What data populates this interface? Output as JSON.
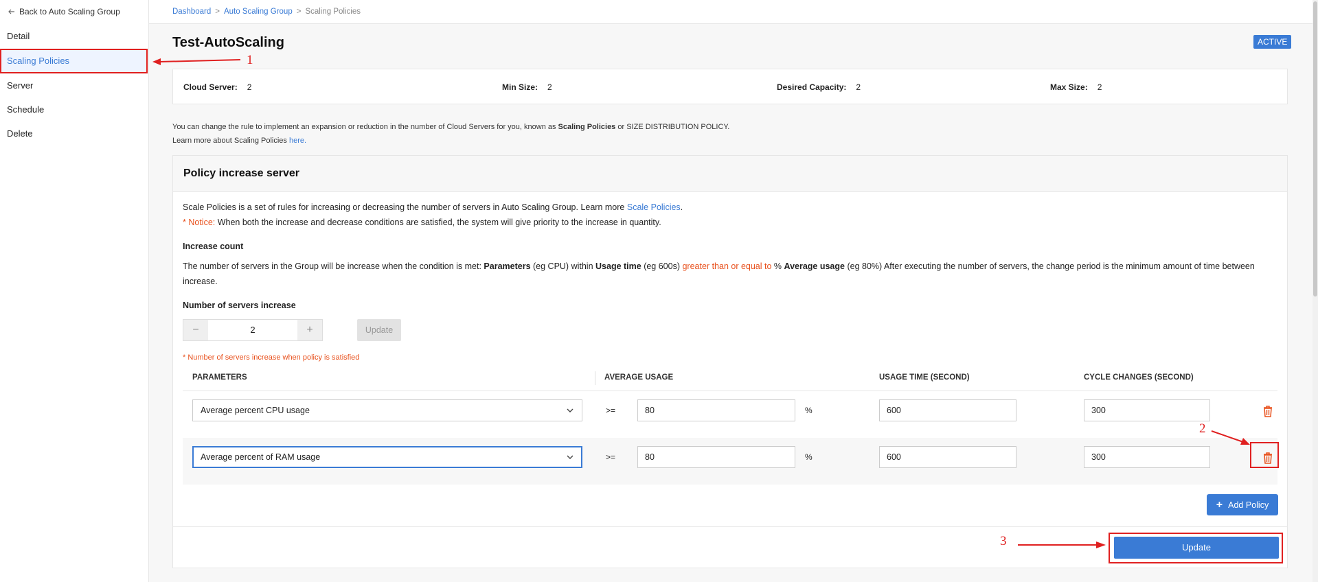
{
  "sidebar": {
    "back_label": "Back to Auto Scaling Group",
    "items": [
      {
        "label": "Detail"
      },
      {
        "label": "Scaling Policies"
      },
      {
        "label": "Server"
      },
      {
        "label": "Schedule"
      },
      {
        "label": "Delete"
      }
    ]
  },
  "breadcrumb": {
    "items": [
      "Dashboard",
      "Auto Scaling Group",
      "Scaling Policies"
    ],
    "separator": ">"
  },
  "page": {
    "title": "Test-AutoScaling",
    "status": "ACTIVE"
  },
  "info": {
    "cloud_server_label": "Cloud Server:",
    "cloud_server_value": "2",
    "min_size_label": "Min Size:",
    "min_size_value": "2",
    "desired_label": "Desired Capacity:",
    "desired_value": "2",
    "max_size_label": "Max Size:",
    "max_size_value": "2"
  },
  "description": {
    "line1_a": "You can change the rule to implement an expansion or reduction in the number of Cloud Servers for you, known as ",
    "line1_b": "Scaling Policies",
    "line1_c": " or SIZE DISTRIBUTION POLICY.",
    "line2_a": "Learn more about Scaling Policies ",
    "line2_link": "here."
  },
  "policy": {
    "heading": "Policy increase server",
    "intro_a": "Scale Policies is a set of rules for increasing or decreasing the number of servers in Auto Scaling Group. Learn more ",
    "intro_link": "Scale Policies",
    "intro_b": ".",
    "notice_label": "* Notice:",
    "notice_text": " When both the increase and decrease conditions are satisfied, the system will give priority to the increase in quantity.",
    "increase_count_title": "Increase count",
    "rule_1": "The number of servers in the Group will be increase when the condition is met: ",
    "rule_params": "Parameters",
    "rule_2": " (eg CPU) within ",
    "rule_usage_time": "Usage time",
    "rule_3": " (eg 600s) ",
    "rule_gte": "greater than or equal to",
    "rule_4": " % ",
    "rule_avg": "Average usage",
    "rule_5": " (eg 80%) After executing the number of servers, the change period is the minimum amount of time between",
    "rule_6": "increase.",
    "servers_increase_title": "Number of servers increase",
    "stepper_minus": "−",
    "stepper_value": "2",
    "stepper_plus": "+",
    "update_small_label": "Update",
    "hint": "* Number of servers increase when policy is satisfied"
  },
  "table": {
    "headers": [
      "PARAMETERS",
      "AVERAGE USAGE",
      "USAGE TIME (SECOND)",
      "CYCLE CHANGES (SECOND)"
    ],
    "rows": [
      {
        "parameter": "Average percent CPU usage",
        "operator": ">=",
        "average_usage": "80",
        "unit": "%",
        "usage_time": "600",
        "cycle_changes": "300"
      },
      {
        "parameter": "Average percent of RAM usage",
        "operator": ">=",
        "average_usage": "80",
        "unit": "%",
        "usage_time": "600",
        "cycle_changes": "300"
      }
    ]
  },
  "actions": {
    "add_policy_icon": "+",
    "add_policy_label": "Add Policy",
    "update_label": "Update"
  },
  "annotations": {
    "one": "1",
    "two": "2",
    "three": "3",
    "color": "#e02020"
  },
  "icons": {
    "back": "arrow-left-icon",
    "chevron": "chevron-down-icon",
    "trash": "trash-icon",
    "plus": "plus-icon"
  },
  "colors": {
    "accent": "#3a7bd5",
    "warning": "#e8501c",
    "annotation": "#e02020"
  }
}
